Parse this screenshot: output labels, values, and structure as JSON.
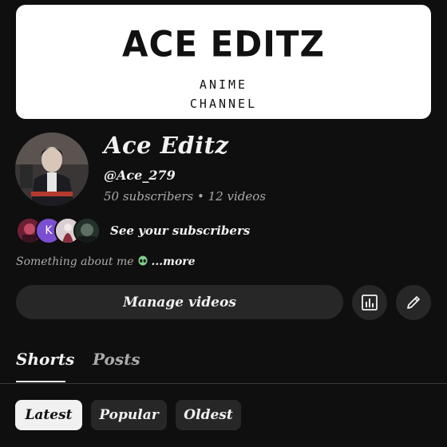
{
  "banner": {
    "title": "ACE EDITZ",
    "subtitle_line1": "ANIME",
    "subtitle_line2": "CHANNEL"
  },
  "channel": {
    "name": "Ace Editz",
    "handle": "@Ace_279",
    "stats": "50 subscribers • 12 videos"
  },
  "subscribers_preview": {
    "avatars": [
      "avatar-1",
      "K",
      "avatar-3",
      "avatar-4"
    ],
    "link_label": "See your subscribers"
  },
  "about": {
    "text": "Something about me",
    "emoji": "alien-icon",
    "more_label": "...more"
  },
  "actions": {
    "manage_label": "Manage videos",
    "analytics_icon": "analytics-icon",
    "edit_icon": "pencil-icon"
  },
  "tabs": [
    {
      "label": "Shorts",
      "active": true
    },
    {
      "label": "Posts",
      "active": false
    }
  ],
  "filters": [
    {
      "label": "Latest",
      "active": true
    },
    {
      "label": "Popular",
      "active": false
    },
    {
      "label": "Oldest",
      "active": false
    }
  ],
  "colors": {
    "background": "#0f0f0f",
    "surface": "#272727",
    "text_primary": "#f1f1f1",
    "text_secondary": "#aaaaaa"
  }
}
